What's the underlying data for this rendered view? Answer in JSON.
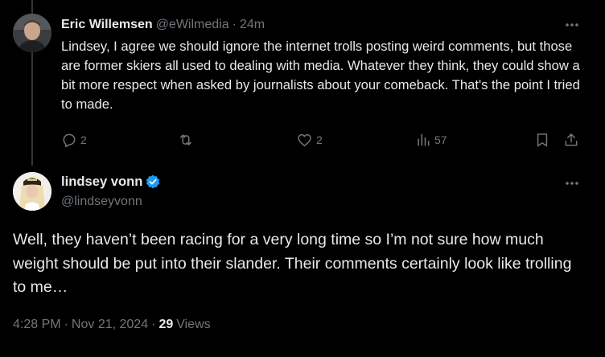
{
  "reply": {
    "author_name": "Eric Willemsen",
    "handle": "@eWilmedia",
    "separator": "·",
    "time": "24m",
    "text": "Lindsey, I agree we should ignore the internet trolls posting weird comments, but those are former skiers all used to dealing with media. Whatever they think, they could show a bit more respect when asked by journalists about your comeback. That's the point I tried to made.",
    "actions": {
      "reply_count": "2",
      "retweet_count": "",
      "like_count": "2",
      "views_count": "57"
    }
  },
  "main_tweet": {
    "author_name": "lindsey vonn",
    "handle": "@lindseyvonn",
    "verified": true,
    "text": "Well, they haven’t been racing for a very long time so I’m not sure how much weight should be put into their slander. Their comments certainly look like trolling to me…",
    "time": "4:28 PM",
    "separator1": "·",
    "date": "Nov 21, 2024",
    "separator2": "·",
    "views_count": "29",
    "views_label": "Views"
  },
  "icons": {
    "more": "more-horizontal-icon",
    "reply": "reply-bubble-icon",
    "retweet": "retweet-icon",
    "like": "heart-icon",
    "views": "analytics-bar-icon",
    "bookmark": "bookmark-icon",
    "share": "share-upload-icon",
    "verified": "verified-badge-icon"
  },
  "colors": {
    "background": "#000000",
    "text_primary": "#e7e9ea",
    "text_secondary": "#71767b",
    "verified_blue": "#1d9bf0",
    "thread_line": "#333639"
  }
}
